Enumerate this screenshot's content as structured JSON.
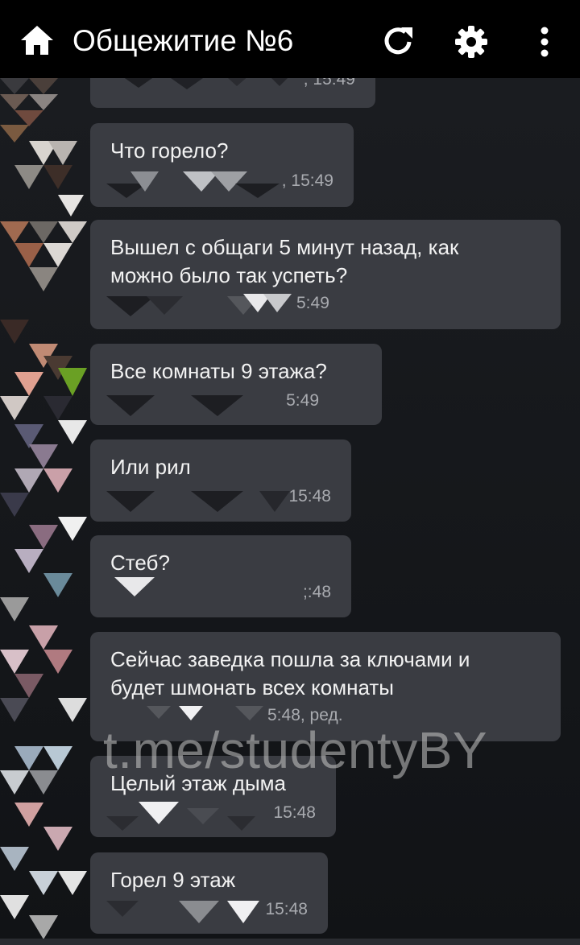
{
  "header": {
    "title": "Общежитие №6",
    "home_icon": "home-icon",
    "refresh_icon": "refresh-icon",
    "settings_icon": "gear-icon",
    "menu_icon": "more-vertical-icon"
  },
  "messages": [
    {
      "text": "",
      "meta": ", 15:49"
    },
    {
      "text": "Что горело?",
      "meta": ", 15:49"
    },
    {
      "text": "Вышел с общаги 5 минут назад, как\nможно было так успеть?",
      "meta": "5:49"
    },
    {
      "text": "Все комнаты 9 этажа?",
      "meta": "5:49"
    },
    {
      "text": "Или рил",
      "meta": "15:48"
    },
    {
      "text": "Стеб?",
      "meta": ";:48"
    },
    {
      "text": "Сейчас заведка пошла за ключами и\nбудет шмонать всех комнаты",
      "meta": "5:48, ред."
    },
    {
      "text": "Целый этаж дыма",
      "meta": "15:48"
    },
    {
      "text": "Горел 9 этаж",
      "meta": "15:48"
    }
  ],
  "watermark": "t.me/studentyBY",
  "colors": {
    "header_bg": "#000000",
    "feed_bg": "#131519",
    "bubble_bg": "#3a3c42",
    "text": "#f2f2f2",
    "meta": "#a9abb0"
  }
}
